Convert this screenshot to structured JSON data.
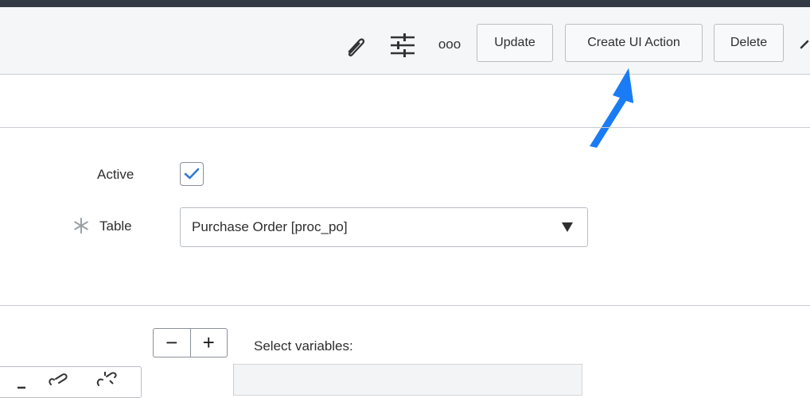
{
  "toolbar": {
    "update_label": "Update",
    "create_ui_action_label": "Create UI Action",
    "delete_label": "Delete",
    "more_label": "ooo"
  },
  "form": {
    "active_label": "Active",
    "active_checked": true,
    "table_label": "Table",
    "table_value": "Purchase Order [proc_po]",
    "table_required": true
  },
  "variables": {
    "select_label": "Select variables:"
  },
  "colors": {
    "accent_blue": "#1a7cf5",
    "checkmark": "#2f7cd8"
  }
}
